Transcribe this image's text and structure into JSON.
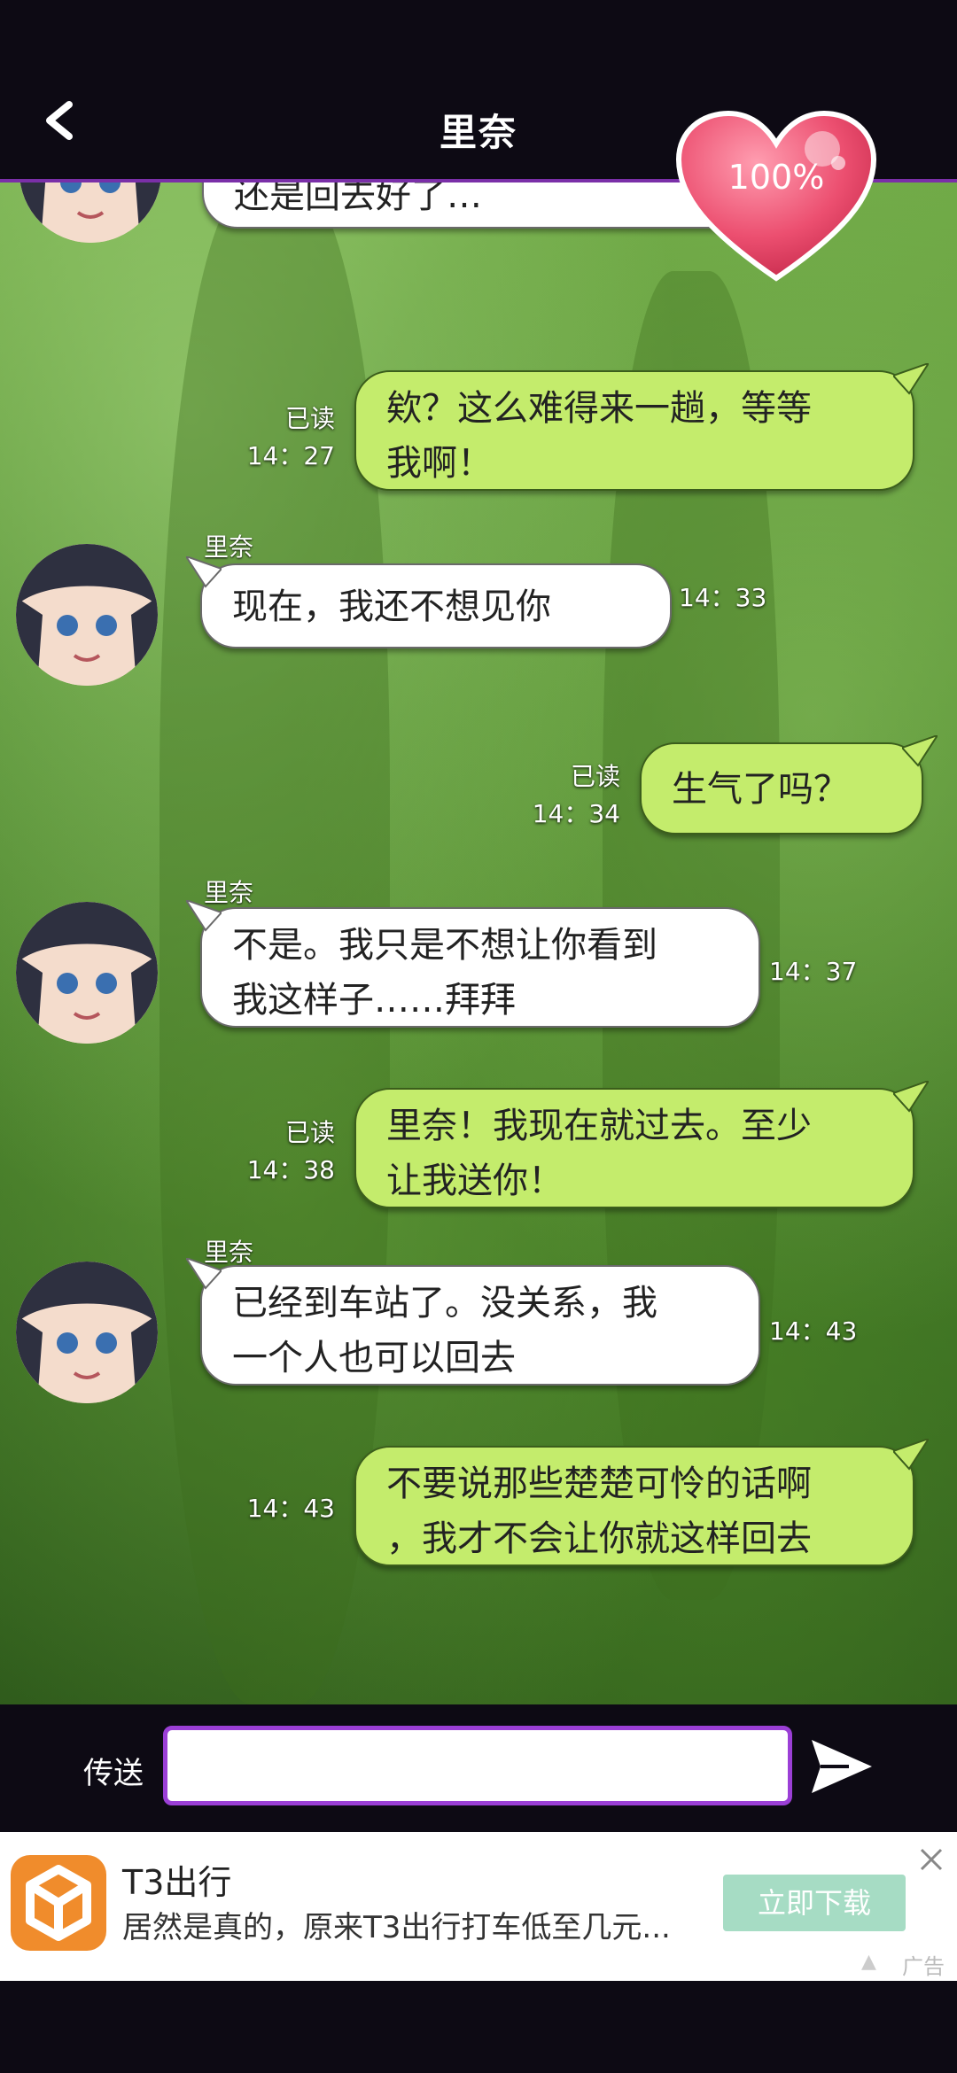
{
  "header": {
    "title": "里奈",
    "affinity": "100%"
  },
  "partial_message": {
    "text": "还是回去好了…"
  },
  "messages": [
    {
      "side": "right",
      "read": "已读",
      "time": "14：27",
      "lines": [
        "欸？这么难得来一趟，等等",
        "我啊！"
      ]
    },
    {
      "side": "left",
      "sender": "里奈",
      "time": "14：33",
      "lines": [
        "现在，我还不想见你"
      ]
    },
    {
      "side": "right",
      "read": "已读",
      "time": "14：34",
      "lines": [
        "生气了吗？"
      ]
    },
    {
      "side": "left",
      "sender": "里奈",
      "time": "14：37",
      "lines": [
        "不是。我只是不想让你看到",
        "我这样子……拜拜"
      ]
    },
    {
      "side": "right",
      "read": "已读",
      "time": "14：38",
      "lines": [
        "里奈！我现在就过去。至少",
        "让我送你！"
      ]
    },
    {
      "side": "left",
      "sender": "里奈",
      "time": "14：43",
      "lines": [
        "已经到车站了。没关系，我",
        "一个人也可以回去"
      ]
    },
    {
      "side": "right",
      "time": "14：43",
      "lines": [
        "不要说那些楚楚可怜的话啊",
        "，我才不会让你就这样回去"
      ]
    }
  ],
  "input": {
    "label": "传送",
    "value": ""
  },
  "ad": {
    "title": "T3出行",
    "description": "居然是真的，原来T3出行打车低至几元...",
    "button": "立即下载",
    "tag": "广告"
  },
  "colors": {
    "accent": "#9b3fd6",
    "bubble_green": "#c4ec6c",
    "heart": "#e84a6b"
  }
}
